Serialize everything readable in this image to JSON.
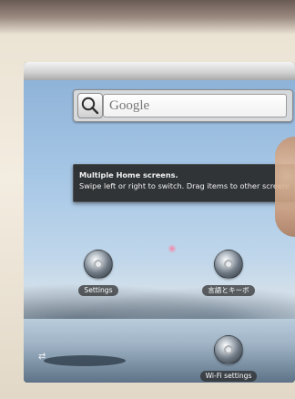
{
  "search": {
    "placeholder": "Google"
  },
  "hint": {
    "title": "Multiple Home screens.",
    "body": "Swipe left or right to switch. Drag items to other screens."
  },
  "shortcuts": [
    {
      "label": "Settings"
    },
    {
      "label": "言語とキーボ"
    },
    {
      "label": "Wi-Fi settings"
    }
  ],
  "corner": {
    "glyph": "⇄"
  },
  "icons": {
    "search": "search-icon",
    "shortcut": "app-shortcut-icon"
  },
  "colors": {
    "tooltip_bg": "#232323",
    "label_bg": "#282828"
  }
}
